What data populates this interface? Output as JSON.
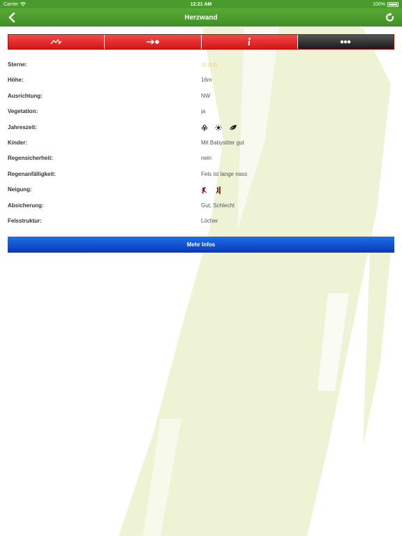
{
  "status": {
    "carrier": "Carrier",
    "time": "12:21 AM",
    "battery": "100%"
  },
  "nav": {
    "title": "Herzwand",
    "back_icon": "chevron-left-icon",
    "refresh_icon": "refresh-icon"
  },
  "tabs": [
    {
      "icon": "mountain-route-icon"
    },
    {
      "icon": "approach-arrow-icon"
    },
    {
      "icon": "info-icon"
    },
    {
      "icon": "more-dots-icon",
      "selected": true
    }
  ],
  "rows": [
    {
      "label": "Sterne:",
      "value": "",
      "stars": "☆☆☆"
    },
    {
      "label": "Höhe:",
      "value": "16m"
    },
    {
      "label": "Ausrichtung:",
      "value": "NW"
    },
    {
      "label": "Vegetation:",
      "value": "ja"
    },
    {
      "label": "Jahreszeit:",
      "value": "",
      "icons": [
        "spring-flower-icon",
        "summer-sun-icon",
        "autumn-leaf-icon"
      ]
    },
    {
      "label": "Kinder:",
      "value": "Mit Babysitter gut"
    },
    {
      "label": "Regensicherheit:",
      "value": "nein"
    },
    {
      "label": "Regenanfälligkeit:",
      "value": "Fels ist lange nass"
    },
    {
      "label": "Neigung:",
      "value": "",
      "icons": [
        "slab-incline-icon",
        "vertical-incline-icon"
      ]
    },
    {
      "label": "Absicherung:",
      "value": "Gut, Schlecht"
    },
    {
      "label": "Felsstruktur:",
      "value": "Löcher"
    }
  ],
  "more_button": {
    "label": "Mehr Infos"
  },
  "colors": {
    "nav_green": "#4a9b2e",
    "tab_red": "#e02626",
    "tab_selected": "#2a2a2a",
    "button_blue": "#1450d0",
    "background_stroke": "#eef3d6"
  }
}
